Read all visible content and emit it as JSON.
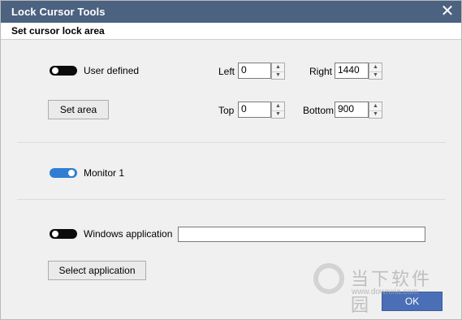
{
  "window": {
    "title": "Lock Cursor Tools",
    "close_glyph": "✕"
  },
  "section": {
    "title": "Set cursor lock area"
  },
  "user_defined": {
    "toggle_state": "off",
    "label": "User defined",
    "set_area_label": "Set area",
    "left_label": "Left",
    "left_value": "0",
    "right_label": "Right",
    "right_value": "1440",
    "top_label": "Top",
    "top_value": "0",
    "bottom_label": "Bottom",
    "bottom_value": "900"
  },
  "monitor": {
    "toggle_state": "on",
    "label": "Monitor 1"
  },
  "windows_app": {
    "toggle_state": "off",
    "label": "Windows application",
    "value": "",
    "select_label": "Select application"
  },
  "ok_label": "OK",
  "watermark": {
    "text": "当下软件园",
    "url": "www.downxia.com"
  },
  "icons": {
    "close": "close-icon",
    "spin_up": "spin-up-icon",
    "spin_down": "spin-down-icon"
  },
  "colors": {
    "titlebar": "#4b6281",
    "toggle_on": "#2f7ed3",
    "toggle_off": "#0b0b0b",
    "ok_button": "#4a6fb6"
  }
}
